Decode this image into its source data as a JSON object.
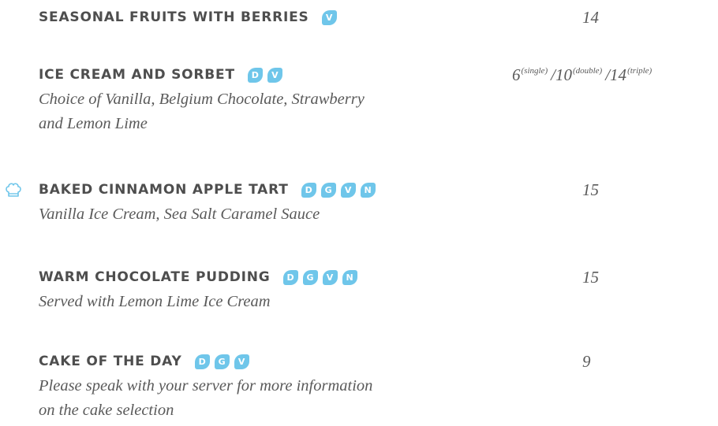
{
  "items": [
    {
      "name": "SEASONAL FRUITS WITH BERRIES",
      "badges": [
        "V"
      ],
      "price": "14",
      "desc_lines": []
    },
    {
      "name": "ICE CREAM AND SORBET",
      "badges": [
        "D",
        "V"
      ],
      "price_parts": [
        {
          "value": "6",
          "note": "(single)"
        },
        {
          "value": "/10",
          "note": "(double)"
        },
        {
          "value": "/14",
          "note": "(triple)"
        }
      ],
      "desc_lines": [
        "Choice of Vanilla, Belgium Chocolate, Strawberry",
        "and Lemon Lime"
      ]
    },
    {
      "name": "BAKED CINNAMON APPLE TART",
      "badges": [
        "D",
        "G",
        "V",
        "N"
      ],
      "price": "15",
      "icon": "chef-hat-icon",
      "desc_lines": [
        "Vanilla Ice Cream, Sea Salt Caramel Sauce"
      ]
    },
    {
      "name": "WARM CHOCOLATE PUDDING",
      "badges": [
        "D",
        "G",
        "V",
        "N"
      ],
      "price": "15",
      "desc_lines": [
        "Served with Lemon Lime Ice Cream"
      ]
    },
    {
      "name": "CAKE OF THE DAY",
      "badges": [
        "D",
        "G",
        "V"
      ],
      "price": "9",
      "desc_lines": [
        "Please speak with your server for more information",
        "on the cake selection"
      ]
    }
  ],
  "colors": {
    "badge": "#6fc6ea",
    "heading": "#4e4e4e",
    "body_text": "#5a5a5a"
  }
}
